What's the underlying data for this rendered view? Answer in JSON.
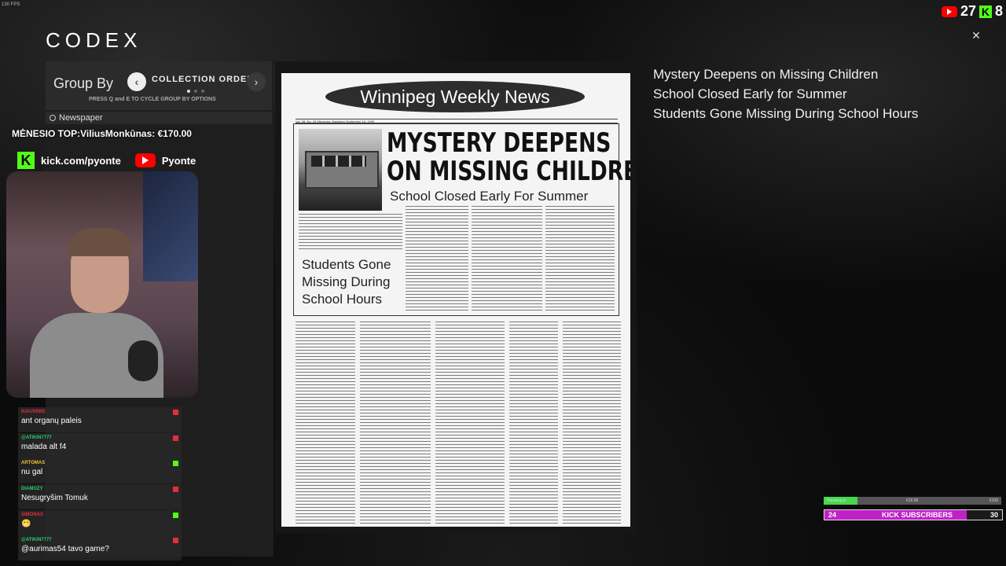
{
  "overlay": {
    "fps": "130 FPS",
    "youtube_count": "27",
    "kick_count": "8",
    "top_donor": "MĖNESIO TOP:ViliusMonkūnas: €170.00",
    "kick_url": "kick.com/pyonte",
    "youtube_name": "Pyonte"
  },
  "codex": {
    "title": "CODEX",
    "group_by_label": "Group By",
    "order_label": "COLLECTION ORDER",
    "hint": "PRESS Q and E TO CYCLE GROUP BY OPTIONS",
    "items": [
      {
        "label": "Newspaper"
      }
    ]
  },
  "document": {
    "masthead": "Winnipeg Weekly News",
    "headline_line1": "MYSTERY DEEPENS",
    "headline_line2": "ON MISSING CHILDREN",
    "subhead": "School Closed Early For Summer",
    "callout": "Students Gone Missing During School Hours",
    "pub_line": "Vol. 38, No. 26   Winnipeg, Manitoba   September 18, 1999"
  },
  "transcript": [
    "Mystery Deepens on Missing Children",
    "School Closed Early for Summer",
    "Students Gone Missing During School Hours"
  ],
  "chat": [
    {
      "user": "KIAUSINIS",
      "text": "ant organų paleis",
      "user_color": "#e0303a"
    },
    {
      "user": "@ATIKIN7777",
      "text": "malada alt f4",
      "user_color": "#2ecc71"
    },
    {
      "user": "ARTOMAS",
      "text": "nu gal",
      "user_color": "#f1c232"
    },
    {
      "user": "DIAMOZY",
      "text": "Nesugryšim Tomuk",
      "user_color": "#2ecc71"
    },
    {
      "user": "SIMONAS",
      "text": "😬",
      "user_color": "#e0303a"
    },
    {
      "user": "@ATIKIN7777",
      "text": "@aurimas54 tavo game?",
      "user_color": "#2ecc71"
    }
  ],
  "goals": {
    "donation_label": "Paaukojusi",
    "donation_current": "€19.00",
    "donation_target": "€100",
    "donation_progress": 0.19,
    "subs_current": "24",
    "subs_label": "KICK SUBSCRIBERS",
    "subs_target": "30",
    "subs_progress": 0.8
  },
  "colors": {
    "kick_green": "#53fc18",
    "youtube_red": "#ff0000",
    "subs_bar": "#c021c6",
    "donation_bar": "#47d84e"
  }
}
